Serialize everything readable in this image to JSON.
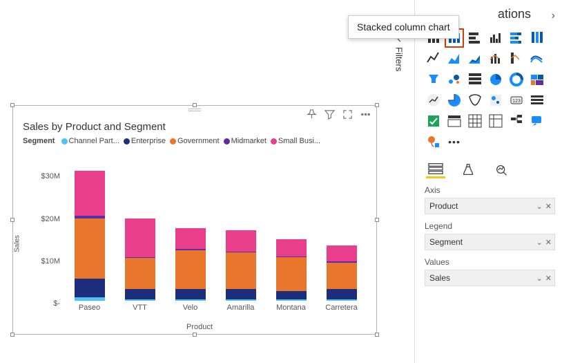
{
  "tooltip": "Stacked column chart",
  "filters_label": "Filters",
  "viz_panel": {
    "title_partial": "ations",
    "mode_tabs": [
      "fields",
      "format",
      "analytics"
    ],
    "sections": {
      "axis": {
        "label": "Axis",
        "value": "Product"
      },
      "legend": {
        "label": "Legend",
        "value": "Segment"
      },
      "values": {
        "label": "Values",
        "value": "Sales"
      }
    }
  },
  "chart_card": {
    "title": "Sales by Product and Segment",
    "legend_label": "Segment",
    "legend_items": [
      {
        "name": "Channel Part...",
        "color": "#4fc3f7"
      },
      {
        "name": "Enterprise",
        "color": "#1c2e7b"
      },
      {
        "name": "Government",
        "color": "#e8762d"
      },
      {
        "name": "Midmarket",
        "color": "#5e2ca5"
      },
      {
        "name": "Small Busi...",
        "color": "#e83e8c"
      }
    ],
    "actions": [
      "pin",
      "filter",
      "focus",
      "more"
    ]
  },
  "chart_data": {
    "type": "bar",
    "stacked": true,
    "title": "Sales by Product and Segment",
    "xlabel": "Product",
    "ylabel": "Sales",
    "ylim": [
      0,
      34000000
    ],
    "yticks": [
      0,
      10000000,
      20000000,
      30000000
    ],
    "ytick_labels": [
      "$-",
      "$10M",
      "$20M",
      "$30M"
    ],
    "categories": [
      "Paseo",
      "VTT",
      "Velo",
      "Amarilla",
      "Montana",
      "Carretera"
    ],
    "series": [
      {
        "name": "Channel Partners",
        "color": "#4fc3f7",
        "values": [
          900000,
          300000,
          300000,
          300000,
          300000,
          300000
        ]
      },
      {
        "name": "Enterprise",
        "color": "#1c2e7b",
        "values": [
          4800000,
          2700000,
          2700000,
          2600000,
          2200000,
          2600000
        ]
      },
      {
        "name": "Government",
        "color": "#e8762d",
        "values": [
          15200000,
          7800000,
          9800000,
          9300000,
          8500000,
          6800000
        ]
      },
      {
        "name": "Midmarket",
        "color": "#5e2ca5",
        "values": [
          700000,
          300000,
          300000,
          300000,
          300000,
          300000
        ]
      },
      {
        "name": "Small Business",
        "color": "#e83e8c",
        "values": [
          11400000,
          9800000,
          5400000,
          5400000,
          4300000,
          4000000
        ]
      }
    ]
  }
}
